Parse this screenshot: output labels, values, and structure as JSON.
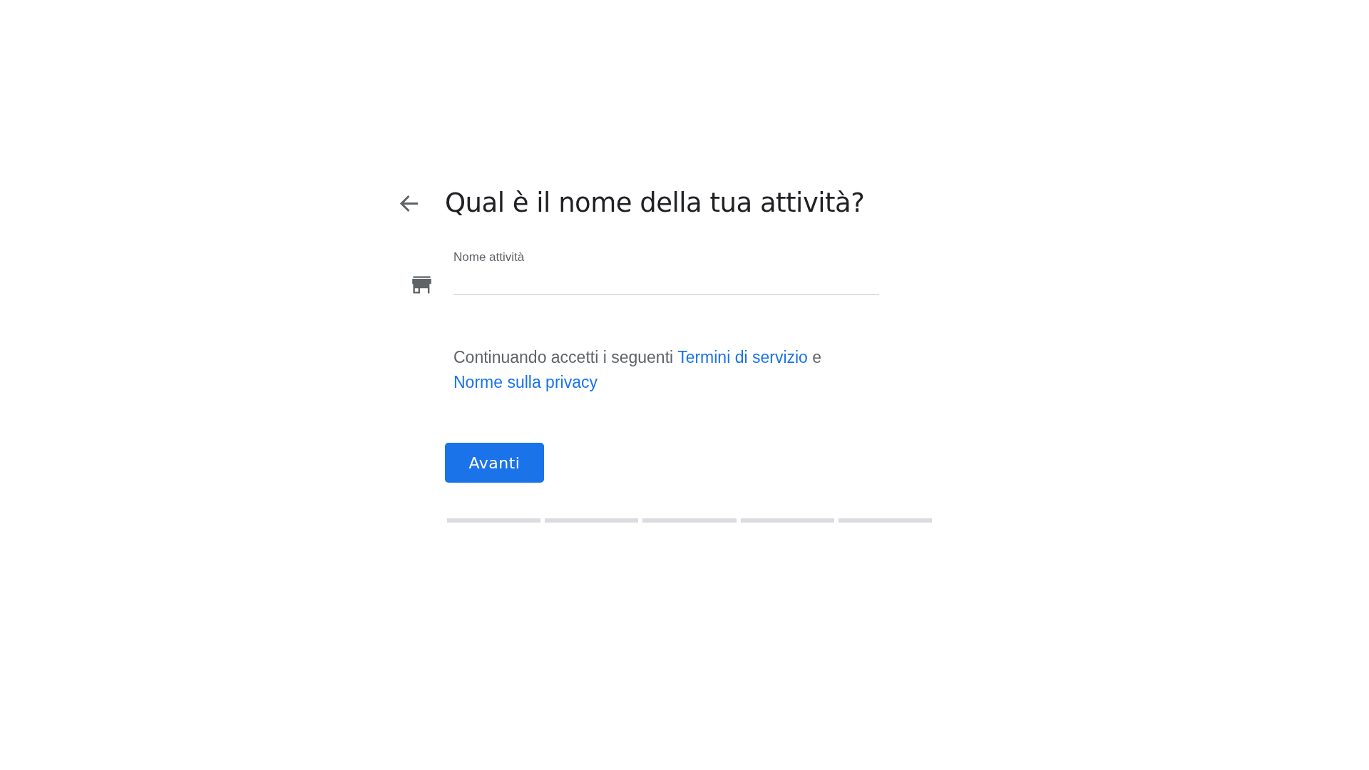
{
  "header": {
    "title": "Qual è il nome della tua attività?"
  },
  "field": {
    "label": "Nome attività"
  },
  "terms": {
    "before": "Continuando accetti i seguenti ",
    "link_1": "Termini di servizio",
    "middle": " e ",
    "link_2": "Norme sulla privacy"
  },
  "button": {
    "label": "Avanti"
  },
  "progress_steps": [
    {
      "completed": false
    },
    {
      "completed": false
    },
    {
      "completed": false
    },
    {
      "completed": false
    },
    {
      "completed": false
    }
  ]
}
